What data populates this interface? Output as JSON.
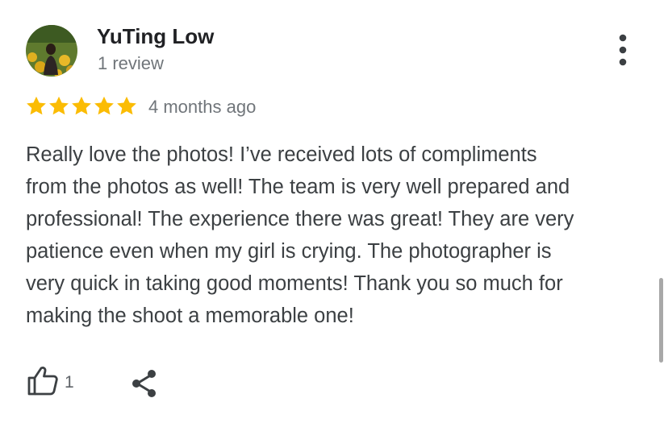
{
  "review": {
    "author": "YuTing Low",
    "author_meta": "1 review",
    "rating": 5,
    "rating_max": 5,
    "time": "4 months ago",
    "text": "Really love the photos! I’ve received lots of compliments\nfrom the photos as well! The team is very well prepared and\nprofessional! The experience there was great! They are very\npatience even when my girl is crying. The photographer is\nvery quick in taking good moments! Thank you so much for\nmaking the shoot a memorable one!"
  },
  "actions": {
    "like_count": "1"
  },
  "icons": {
    "menu": "more-vertical-icon",
    "like": "thumbs-up-icon",
    "share": "share-icon",
    "star": "star-icon"
  },
  "colors": {
    "star": "#fbbc04",
    "title": "#202124",
    "secondary": "#70757a",
    "body_text": "#3c4043"
  }
}
